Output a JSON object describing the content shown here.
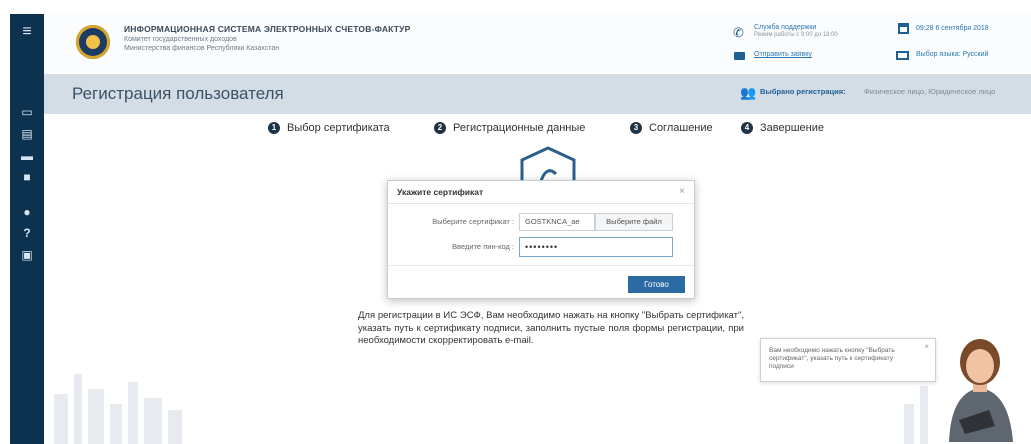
{
  "header": {
    "system_title": "ИНФОРМАЦИОННАЯ СИСТЕМА ЭЛЕКТРОННЫХ СЧЕТОВ-ФАКТУР",
    "org_line1": "Комитет государственных доходов",
    "org_line2": "Министерства финансов Республики Казахстан",
    "support_title": "Служба поддержки",
    "support_hours": "Режим работы с 9:00 до 18:00",
    "send_request": "Отправить заявку",
    "date": "09:28 6 сентября 2018",
    "language": "Выбор языка: Русский"
  },
  "page": {
    "title": "Регистрация пользователя",
    "registration_label": "Выбрано регистрация:",
    "registration_value": "Физическое лицо, Юридическое лицо"
  },
  "steps": [
    {
      "num": "1",
      "label": "Выбор сертификата"
    },
    {
      "num": "2",
      "label": "Регистрационные данные"
    },
    {
      "num": "3",
      "label": "Соглашение"
    },
    {
      "num": "4",
      "label": "Завершение"
    }
  ],
  "modal": {
    "title": "Укажите сертификат",
    "close": "×",
    "cert_label": "Выберите сертификат :",
    "cert_value": "GOSTKNCA_ae",
    "choose_file": "Выберите файл",
    "pin_label": "Введите пин-код :",
    "pin_value": "••••••••",
    "done": "Готово"
  },
  "instructions": "Для регистрации в ИС ЭСФ, Вам необходимо нажать на кнопку \"Выбрать сертификат\", указать путь к сертификату подписи, заполнить пустые поля формы регистрации, при необходимости скорректировать e-mail.",
  "tip": {
    "text": "Вам необходимо нажать кнопку \"Выбрать сертификат\", указать путь к сертификату подписи",
    "close": "×"
  },
  "sidebar_icons": [
    "menu-icon",
    "monitor-icon",
    "document-icon",
    "folder-icon",
    "file-icon",
    "car-icon",
    "help-icon",
    "briefcase-icon"
  ],
  "colors": {
    "sidebar": "#0c3250",
    "header_band": "#d4dde6",
    "accent": "#2b6aa3",
    "link": "#2b78b2"
  }
}
